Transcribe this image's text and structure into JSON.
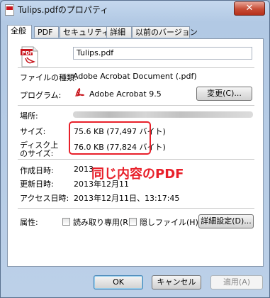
{
  "window": {
    "title": "Tulips.pdfのプロパティ",
    "close_label": "✕"
  },
  "tabs": [
    "全般",
    "PDF",
    "セキュリティ",
    "詳細",
    "以前のバージョン"
  ],
  "general": {
    "file_name": "Tulips.pdf",
    "type_label": "ファイルの種類:",
    "type_value": "Adobe Acrobat Document (.pdf)",
    "program_label": "プログラム:",
    "program_value": "Adobe Acrobat 9.5",
    "change_button": "変更(C)...",
    "location_label": "場所:",
    "size_label": "サイズ:",
    "size_value": "75.6 KB (77,497 バイト)",
    "size_on_disk_label_1": "ディスク上",
    "size_on_disk_label_2": "のサイズ:",
    "size_on_disk_value": "76.0 KB (77,824 バイト)",
    "created_label": "作成日時:",
    "created_value": "2013",
    "modified_label": "更新日時:",
    "modified_value": "2013年12月11",
    "accessed_label": "アクセス日時:",
    "accessed_value": "2013年12月11日、13:17:45",
    "attributes_label": "属性:",
    "readonly_label": "読み取り専用(R)",
    "hidden_label": "隠しファイル(H)",
    "advanced_button": "詳細設定(D)...",
    "pdf_icon_text": "PDF"
  },
  "annotation": {
    "text": "同じ内容のPDF",
    "color": "#e8202a"
  },
  "footer": {
    "ok": "OK",
    "cancel": "キャンセル",
    "apply": "適用(A)"
  }
}
